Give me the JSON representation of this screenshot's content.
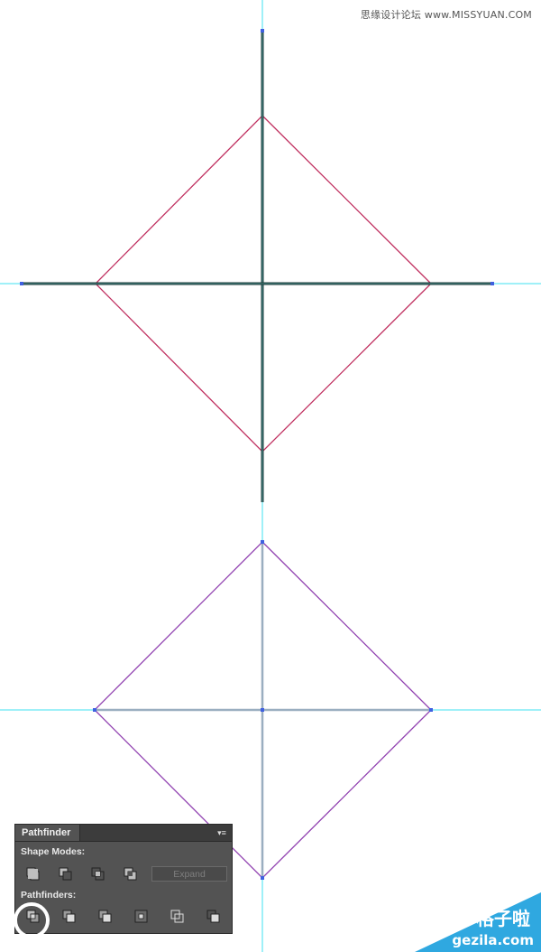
{
  "watermark": "思缘设计论坛 www.MISSYUAN.COM",
  "colors": {
    "guide": "#3fe0f0",
    "top_diamond": "#c03060",
    "bottom_diamond": "#9040b0",
    "cross_line": "#1e3a38",
    "bottom_cross": "#9aaec0",
    "anchor": "#4060e0",
    "panel_bg": "#535353",
    "logo_bg": "#2fa8e0"
  },
  "pathfinder": {
    "tab_title": "Pathfinder",
    "menu_icon": "panel-menu-icon",
    "shape_modes_label": "Shape Modes:",
    "shape_mode_icons": [
      "unite-icon",
      "minus-front-icon",
      "intersect-icon",
      "exclude-icon"
    ],
    "expand_label": "Expand",
    "pathfinders_label": "Pathfinders:",
    "pathfinder_icons": [
      "divide-icon",
      "trim-icon",
      "merge-icon",
      "crop-icon",
      "outline-icon",
      "minus-back-icon"
    ],
    "highlighted": "divide-icon"
  },
  "logo": {
    "cn": "格子啦",
    "url": "gezila.com"
  }
}
